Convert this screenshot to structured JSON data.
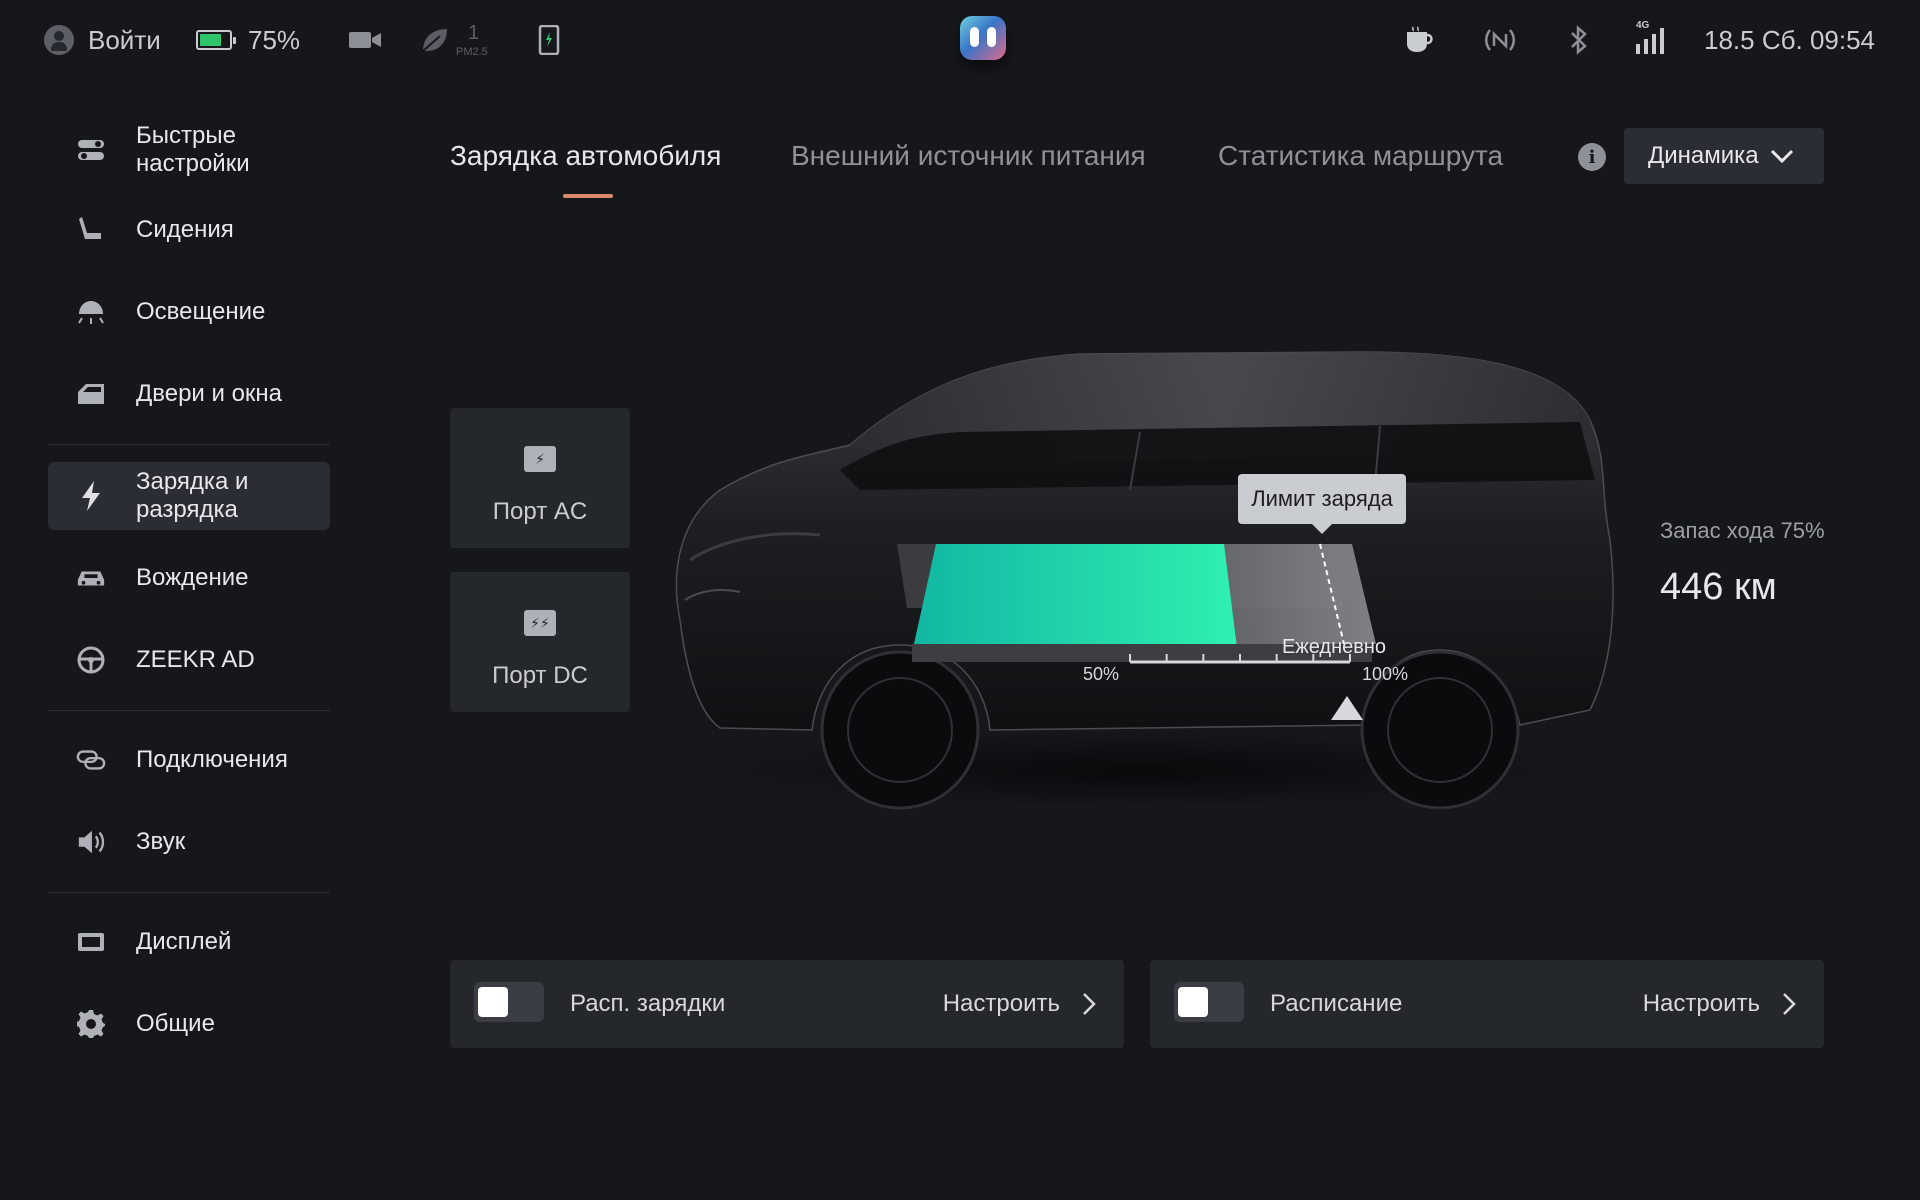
{
  "status_bar": {
    "login_label": "Войти",
    "battery_percent": "75%",
    "battery_level": 0.75,
    "pm_value": "1",
    "pm_unit": "PM2.5",
    "signal_type": "4G",
    "datetime": "18.5 Сб. 09:54",
    "icons": [
      "user-icon",
      "battery-icon",
      "camera-icon",
      "leaf-icon",
      "phone-charge-icon",
      "assistant-mascot",
      "coffee-icon",
      "nfc-off-icon",
      "bluetooth-icon",
      "cellular-signal-icon"
    ]
  },
  "sidebar": {
    "items": [
      {
        "label": "Быстрые настройки",
        "icon": "toggles-icon"
      },
      {
        "label": "Сидения",
        "icon": "seat-icon"
      },
      {
        "label": "Освещение",
        "icon": "light-icon"
      },
      {
        "label": "Двери и окна",
        "icon": "door-icon"
      },
      {
        "label": "Зарядка и разрядка",
        "icon": "lightning-icon",
        "active": true
      },
      {
        "label": "Вождение",
        "icon": "car-icon"
      },
      {
        "label": "ZEEKR AD",
        "icon": "steering-wheel-icon"
      },
      {
        "label": "Подключения",
        "icon": "link-icon"
      },
      {
        "label": "Звук",
        "icon": "speaker-icon"
      },
      {
        "label": "Дисплей",
        "icon": "display-icon"
      },
      {
        "label": "Общие",
        "icon": "gear-icon"
      }
    ]
  },
  "tabs": [
    {
      "label": "Зарядка автомобиля",
      "active": true
    },
    {
      "label": "Внешний источник питания",
      "active": false
    },
    {
      "label": "Статистика маршрута",
      "active": false
    }
  ],
  "mode_dropdown": {
    "value": "Динамика"
  },
  "ports": {
    "ac_label": "Порт AC",
    "dc_label": "Порт DC"
  },
  "charge": {
    "limit_tooltip": "Лимит заряда",
    "daily_label": "Ежедневно",
    "scale_min": "50%",
    "scale_max": "100%",
    "current_soc": 0.75,
    "limit_value": 1.0,
    "colors": {
      "soc_start": "#12b7a2",
      "soc_end": "#2ff0b0",
      "accent": "#d98a6c"
    }
  },
  "range": {
    "title": "Запас хода 75%",
    "value": "446 км"
  },
  "schedule_cards": [
    {
      "label": "Расп. зарядки",
      "action": "Настроить",
      "enabled": false
    },
    {
      "label": "Расписание",
      "action": "Настроить",
      "enabled": false
    }
  ]
}
